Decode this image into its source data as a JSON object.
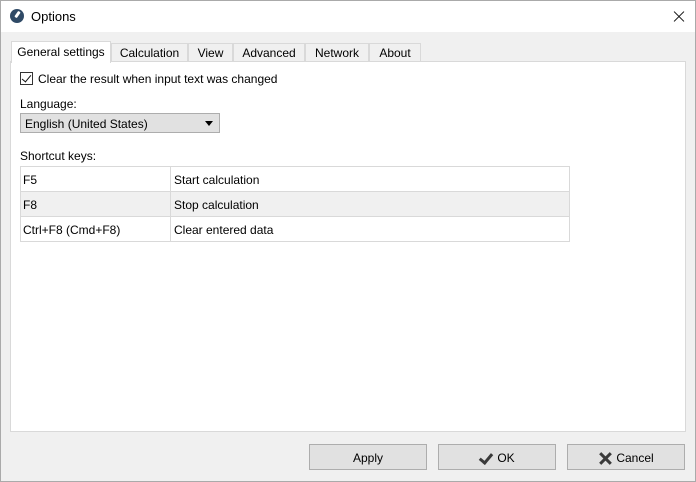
{
  "window": {
    "title": "Options",
    "icon": "app-icon"
  },
  "tabs": [
    {
      "label": "General settings",
      "active": true
    },
    {
      "label": "Calculation"
    },
    {
      "label": "View"
    },
    {
      "label": "Advanced"
    },
    {
      "label": "Network"
    },
    {
      "label": "About"
    }
  ],
  "general": {
    "clear_result_label": "Clear the result when input text was changed",
    "clear_result_checked": true,
    "language_label": "Language:",
    "language_value": "English (United States)",
    "shortcut_label": "Shortcut keys:",
    "shortcuts": [
      {
        "key": "F5",
        "action": "Start calculation"
      },
      {
        "key": "F8",
        "action": "Stop calculation"
      },
      {
        "key": "Ctrl+F8 (Cmd+F8)",
        "action": "Clear entered data"
      }
    ]
  },
  "buttons": {
    "apply": "Apply",
    "ok": "OK",
    "cancel": "Cancel"
  }
}
